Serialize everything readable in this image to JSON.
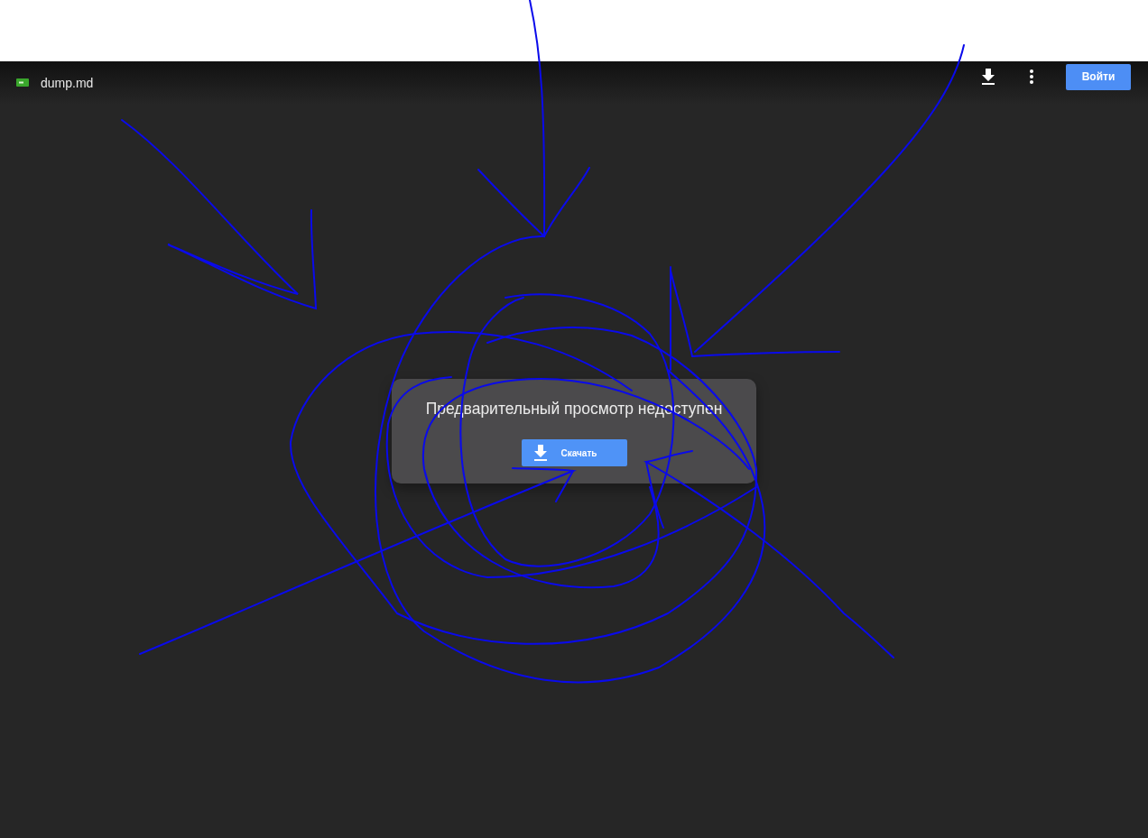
{
  "header": {
    "file_name": "dump.md",
    "sign_in_button": "Войти"
  },
  "dialog": {
    "message": "Предварительный просмотр недоступен",
    "download_button": "Скачать"
  }
}
